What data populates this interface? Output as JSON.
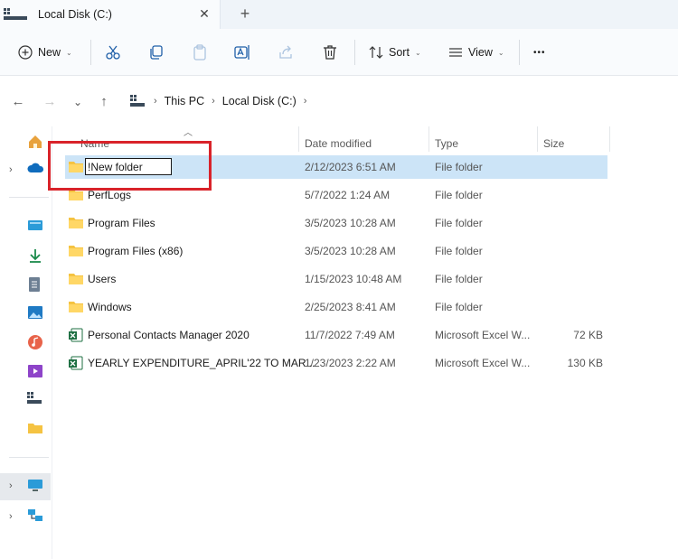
{
  "tab": {
    "title": "Local Disk (C:)",
    "close_glyph": "✕",
    "new_tab_glyph": "+"
  },
  "toolbar": {
    "new_label": "New",
    "sort_label": "Sort",
    "view_label": "View",
    "more_glyph": "•••",
    "caret": "⌄",
    "icons": [
      "cut-icon",
      "copy-icon",
      "paste-icon",
      "rename-icon",
      "share-icon",
      "delete-icon"
    ]
  },
  "nav": {
    "back": "←",
    "forward": "→",
    "recent": "⌄",
    "up": "↑",
    "breadcrumbs": [
      "This PC",
      "Local Disk (C:)"
    ],
    "crumb_sep": "›"
  },
  "columns": {
    "name": "Name",
    "date": "Date modified",
    "type": "Type",
    "size": "Size"
  },
  "rename_value": "!New folder",
  "files": [
    {
      "name": "",
      "date": "2/12/2023 6:51 AM",
      "type": "File folder",
      "size": "",
      "icon": "folder-icon"
    },
    {
      "name": "PerfLogs",
      "date": "5/7/2022 1:24 AM",
      "type": "File folder",
      "size": "",
      "icon": "folder-icon"
    },
    {
      "name": "Program Files",
      "date": "3/5/2023 10:28 AM",
      "type": "File folder",
      "size": "",
      "icon": "folder-icon"
    },
    {
      "name": "Program Files (x86)",
      "date": "3/5/2023 10:28 AM",
      "type": "File folder",
      "size": "",
      "icon": "folder-icon"
    },
    {
      "name": "Users",
      "date": "1/15/2023 10:48 AM",
      "type": "File folder",
      "size": "",
      "icon": "folder-icon"
    },
    {
      "name": "Windows",
      "date": "2/25/2023 8:41 AM",
      "type": "File folder",
      "size": "",
      "icon": "folder-icon"
    },
    {
      "name": "Personal Contacts Manager 2020",
      "date": "11/7/2022 7:49 AM",
      "type": "Microsoft Excel W...",
      "size": "72 KB",
      "icon": "excel-icon"
    },
    {
      "name": "YEARLY EXPENDITURE_APRIL'22 TO MAR...",
      "date": "1/23/2023 2:22 AM",
      "type": "Microsoft Excel W...",
      "size": "130 KB",
      "icon": "excel-icon"
    }
  ],
  "colors": {
    "accent": "#0078d4",
    "selection": "#cce4f7",
    "highlight": "#d9232a",
    "folder": "#f5c342"
  }
}
